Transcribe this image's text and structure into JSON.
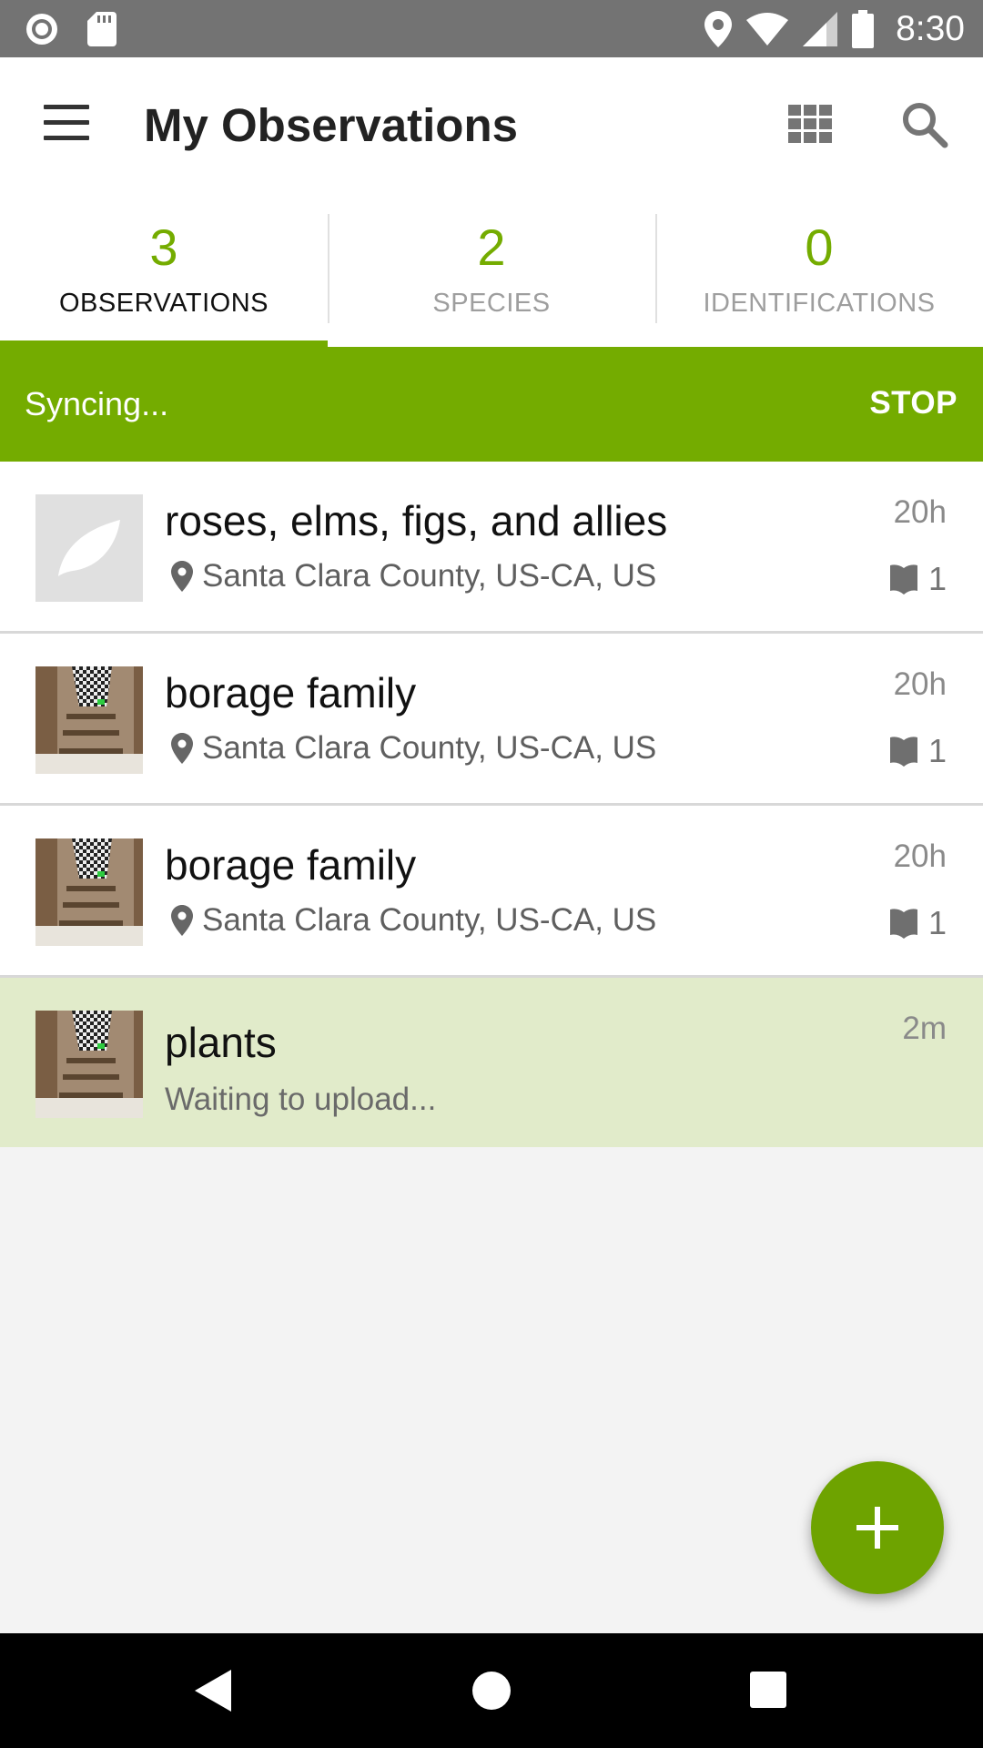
{
  "status_bar": {
    "time": "8:30",
    "left_icons": [
      "record-icon",
      "sd-card-icon"
    ],
    "right_icons": [
      "location-icon",
      "wifi-icon",
      "signal-icon",
      "battery-icon"
    ]
  },
  "app_bar": {
    "title": "My Observations",
    "menu_icon": "hamburger-menu-icon",
    "grid_icon": "grid-view-icon",
    "search_icon": "search-icon"
  },
  "tabs": [
    {
      "count": "3",
      "label": "OBSERVATIONS",
      "active": true
    },
    {
      "count": "2",
      "label": "SPECIES",
      "active": false
    },
    {
      "count": "0",
      "label": "IDENTIFICATIONS",
      "active": false
    }
  ],
  "sync": {
    "text": "Syncing...",
    "stop_label": "STOP"
  },
  "observations": [
    {
      "title": "roses, elms, figs, and allies",
      "location": "Santa Clara County, US-CA, US",
      "time": "20h",
      "ids": "1",
      "thumbnail": "leaf-placeholder-icon"
    },
    {
      "title": "borage family",
      "location": "Santa Clara County, US-CA, US",
      "time": "20h",
      "ids": "1",
      "thumbnail": "photo"
    },
    {
      "title": "borage family",
      "location": "Santa Clara County, US-CA, US",
      "time": "20h",
      "ids": "1",
      "thumbnail": "photo"
    },
    {
      "title": "plants",
      "subtitle": "Waiting to upload...",
      "time": "2m",
      "thumbnail": "photo"
    }
  ],
  "colors": {
    "accent": "#74ac00",
    "pending_row": "#e1ebca",
    "status_bar": "#737373"
  },
  "fab_icon": "plus-icon",
  "nav_bar": {
    "back_icon": "back-triangle-icon",
    "home_icon": "home-circle-icon",
    "recents_icon": "recents-square-icon"
  }
}
